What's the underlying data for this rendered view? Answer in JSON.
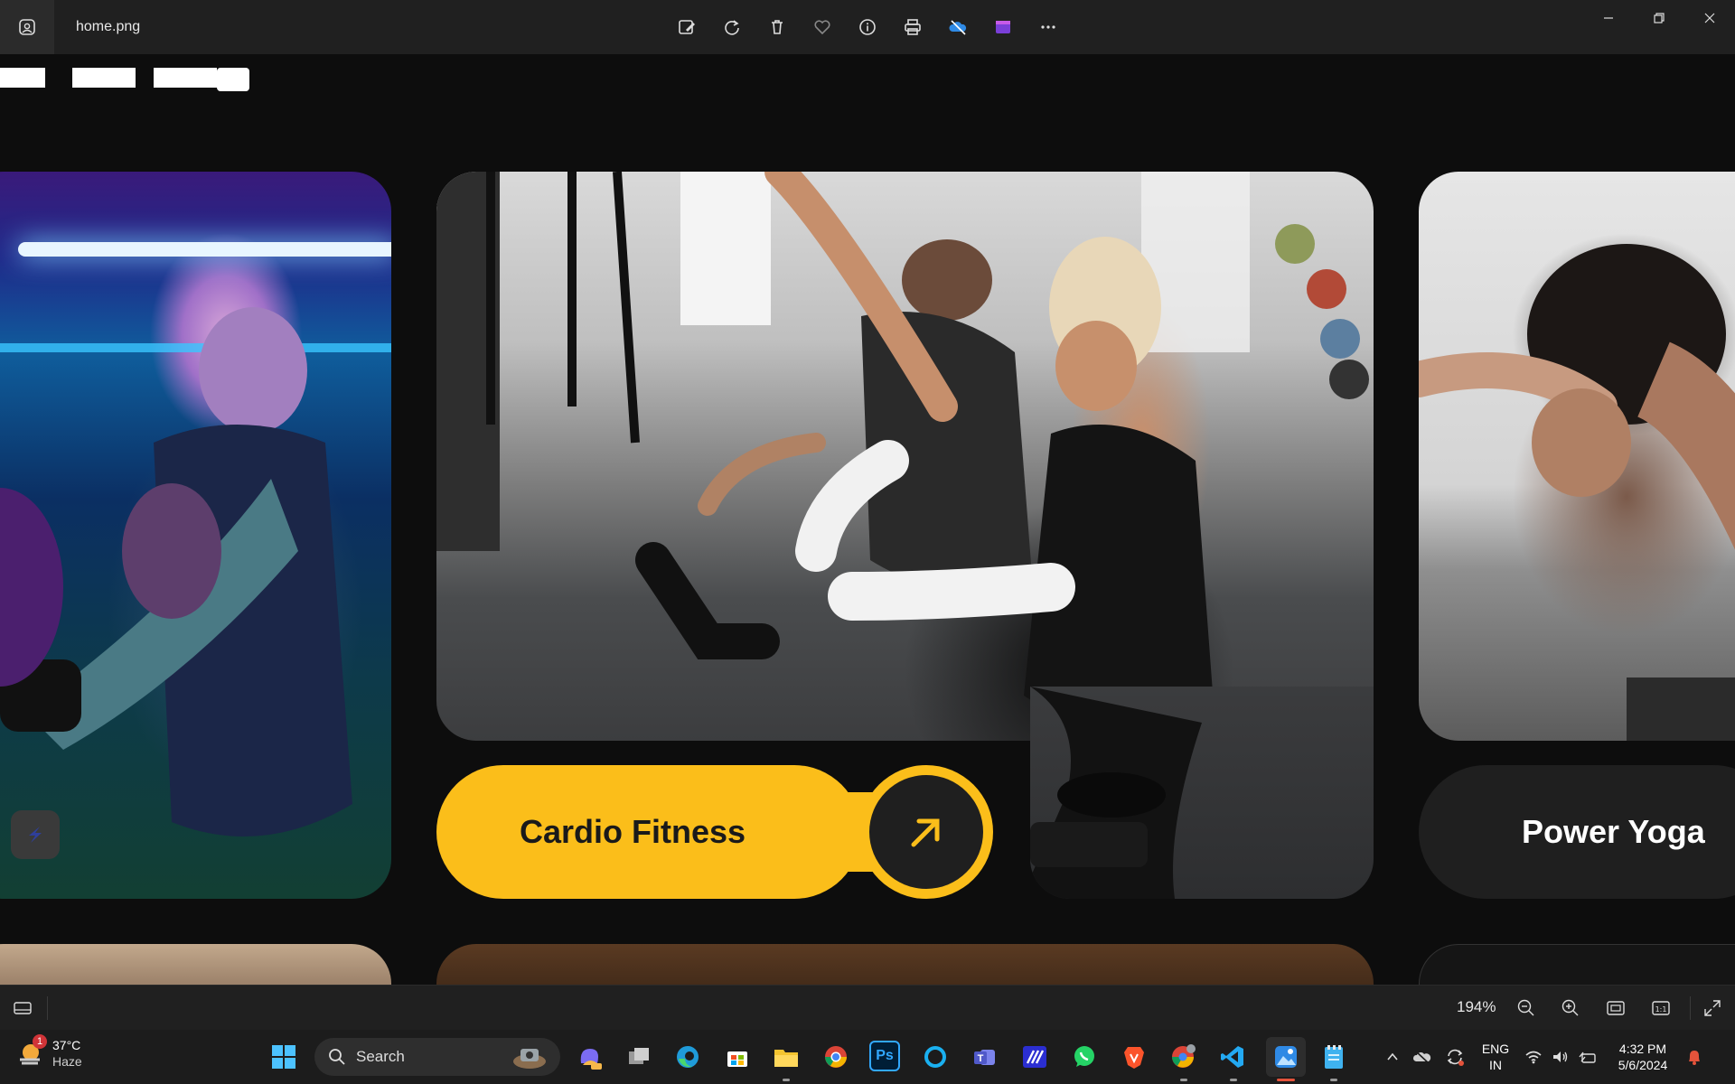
{
  "window": {
    "filename": "home.png",
    "toolbar_icons": [
      "edit-image-icon",
      "rotate-icon",
      "delete-icon",
      "favorite-icon",
      "info-icon",
      "print-icon",
      "onedrive-icon",
      "clipchamp-icon",
      "more-icon"
    ],
    "window_controls": [
      "minimize-icon",
      "restore-icon",
      "close-icon"
    ]
  },
  "image_content": {
    "cards": [
      {
        "label": "Cardio Fitness",
        "style": "active",
        "accent": "#fbbe1a",
        "button_icon": "arrow-up-right-icon"
      },
      {
        "label": "Power Yoga",
        "style": "inactive",
        "accent": "#1f1f1f"
      }
    ]
  },
  "viewer_status": {
    "zoom": "194%",
    "icons": [
      "filmstrip-icon",
      "zoom-out-icon",
      "zoom-in-icon",
      "fit-icon",
      "actual-size-icon",
      "fullscreen-icon"
    ]
  },
  "taskbar": {
    "weather": {
      "temp": "37°C",
      "condition": "Haze",
      "badge": "1"
    },
    "search_placeholder": "Search",
    "apps": [
      "windows-start-icon",
      "copilot-icon",
      "task-view-icon",
      "edge-icon",
      "store-icon",
      "file-explorer-icon",
      "chrome-icon",
      "photoshop-icon",
      "cortana-icon",
      "teams-icon",
      "zoho-icon",
      "whatsapp-icon",
      "brave-icon",
      "chrome-profile-icon",
      "vscode-icon",
      "photos-icon",
      "notepad-icon"
    ],
    "photoshop_label": "Ps",
    "tray": {
      "language": "ENG",
      "region": "IN",
      "time": "4:32 PM",
      "date": "5/6/2024"
    }
  },
  "colors": {
    "accent_yellow": "#fbbe1a",
    "titlebar": "#202020",
    "taskbar": "#1c1c1c"
  }
}
